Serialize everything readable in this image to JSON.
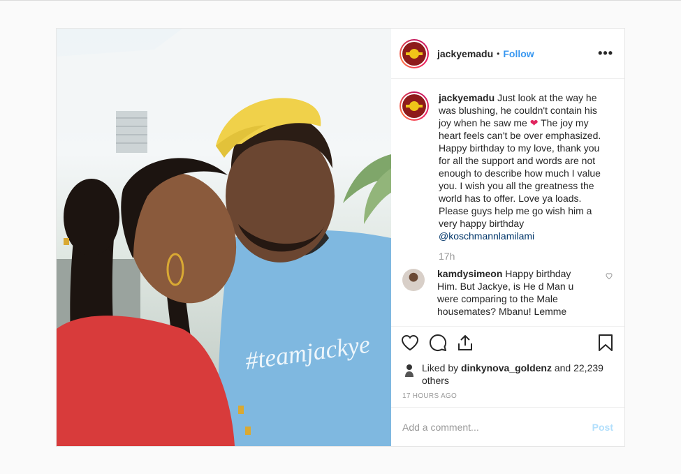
{
  "post": {
    "username": "jackyemadu",
    "follow_label": "Follow",
    "dot": "•",
    "more_label": "•••",
    "caption": {
      "username": "jackyemadu",
      "text_before_emoji": "Just look at the way he was blushing, he couldn't contain his joy when he saw me",
      "emoji": "❤",
      "text_after_emoji": "The joy my heart feels can't be over emphasized. Happy birthday to my love, thank you for all the support and words are not enough to describe how much I value you. I wish you all the greatness the world has to offer. Love ya loads. Please guys help me go wish him a very happy birthday",
      "mention": "@koschmannlamilami",
      "time": "17h"
    },
    "comments": [
      {
        "username": "kamdysimeon",
        "text": "Happy birthday Him. But Jackye, is He d Man u were comparing to the Male housemates? Mbanu! Lemme"
      }
    ],
    "liked_by": {
      "prefix": "Liked by",
      "user": "dinkynova_goldenz",
      "suffix": "and 22,239 others"
    },
    "timestamp": "17 HOURS AGO",
    "add_comment_placeholder": "Add a comment...",
    "post_button": "Post",
    "photo_text": "#teamjackye"
  },
  "colors": {
    "link": "#3897f0",
    "mention": "#003569",
    "post_button_disabled": "#b2dffc",
    "heart": "#e0245e"
  }
}
